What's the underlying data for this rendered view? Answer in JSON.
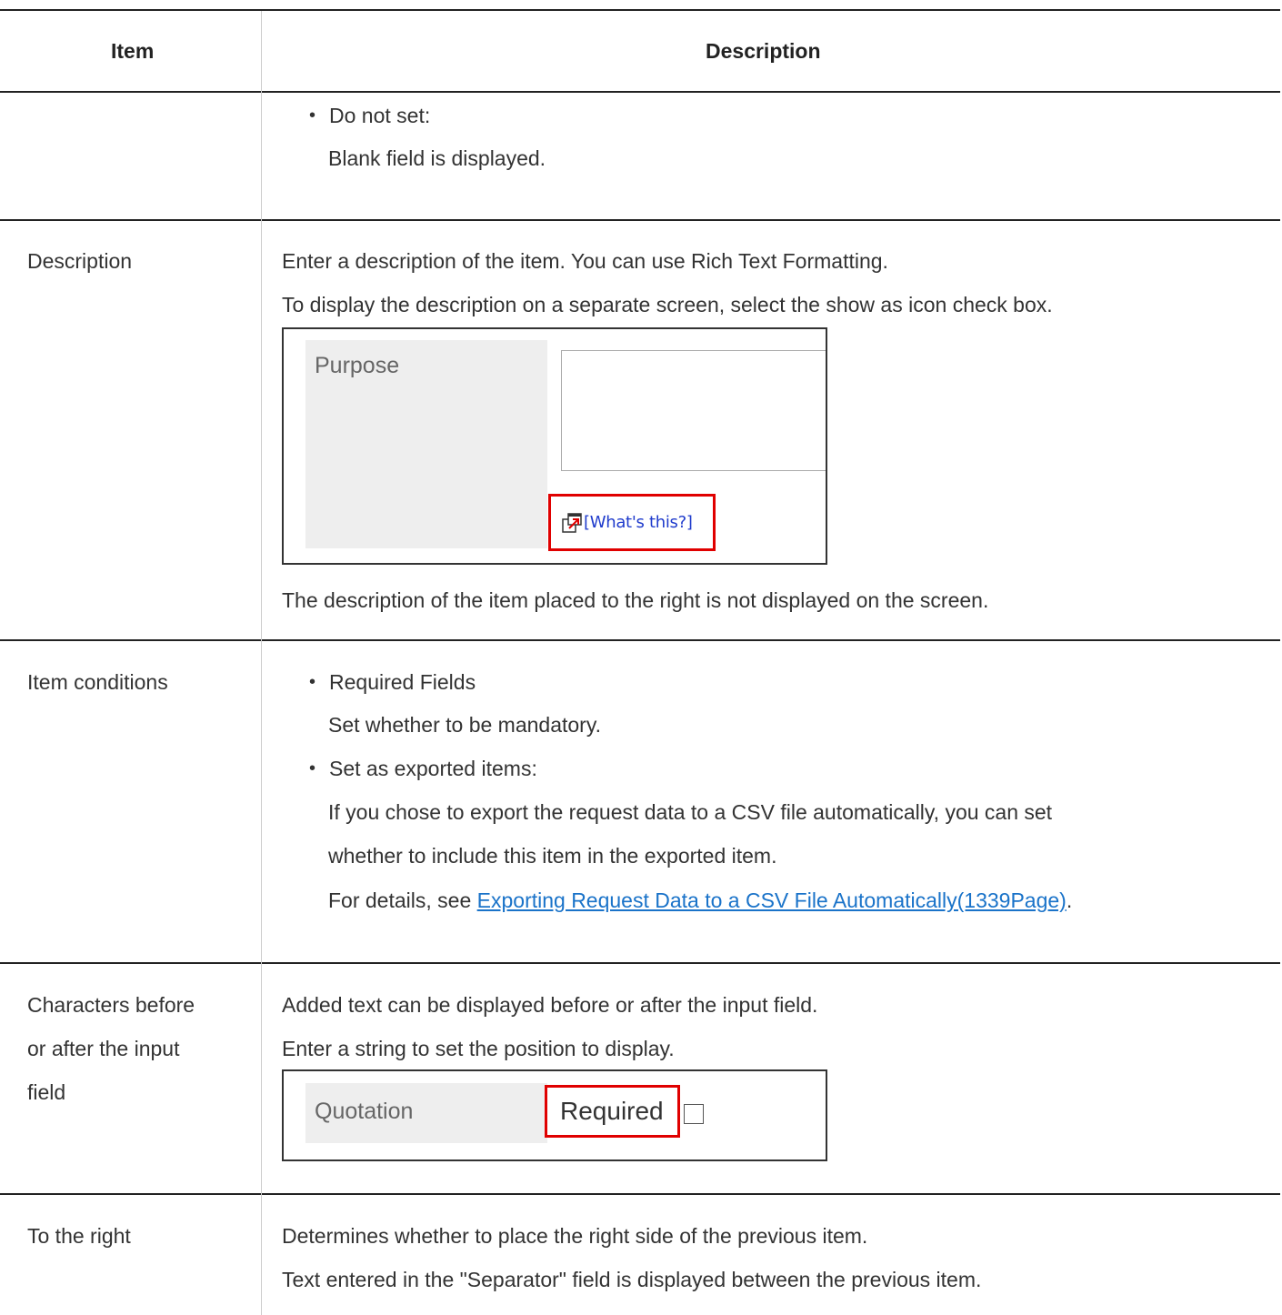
{
  "header": {
    "item": "Item",
    "description": "Description"
  },
  "rows": {
    "top": {
      "bullet": "Do not set:",
      "line": "Blank field is displayed."
    },
    "description": {
      "item": "Description",
      "line1": "Enter a description of the item. You can use Rich Text Formatting.",
      "line2": "To display the description on a separate screen, select the show as icon check box.",
      "screenshot": {
        "label": "Purpose",
        "link": "[What's this?]",
        "icon": "popup-window-icon"
      },
      "line3": "The description of the item placed to the right is not displayed on the screen."
    },
    "conditions": {
      "item": "Item conditions",
      "bullet1": "Required Fields",
      "bullet1_desc": "Set whether to be mandatory.",
      "bullet2": "Set as exported items:",
      "bullet2_desc1": "If you chose to export the request data to a CSV file automatically, you can set",
      "bullet2_desc2": "whether to include this item in the exported item.",
      "details_prefix": "For details, see ",
      "details_link": "Exporting Request Data to a CSV File Automatically(1339Page)",
      "details_suffix": "."
    },
    "characters": {
      "item_line1": "Characters before",
      "item_line2": "or after the input",
      "item_line3": "field",
      "line1": "Added text can be displayed before or after the input field.",
      "line2": "Enter a string to set the position to display.",
      "screenshot": {
        "label": "Quotation",
        "value": "Required"
      }
    },
    "right": {
      "item": "To the right",
      "line1": "Determines whether to place the right side of the previous item.",
      "line2": "Text entered in the \"Separator\" field is displayed between the previous item."
    }
  },
  "colors": {
    "link": "#1a73c9",
    "highlight": "#e00000",
    "rule": "#222222"
  }
}
